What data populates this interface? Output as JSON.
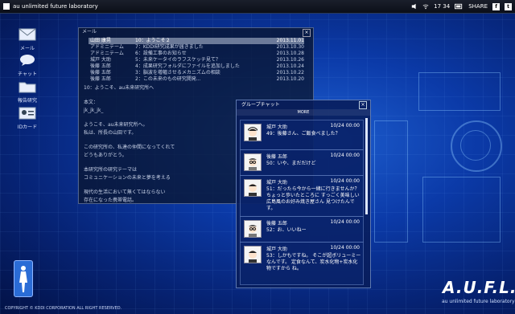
{
  "topbar": {
    "brand": "au unlimited future laboratory",
    "time": "17 34",
    "share": "SHARE",
    "f": "f",
    "t": "t"
  },
  "desktop": [
    {
      "label": "メール",
      "icon": "mail-icon"
    },
    {
      "label": "チャット",
      "icon": "chat-icon"
    },
    {
      "label": "報告研究",
      "icon": "folder-icon"
    },
    {
      "label": "IDカード",
      "icon": "id-card-icon"
    }
  ],
  "mail": {
    "title": "メール",
    "close": "×",
    "rows": [
      {
        "from": "山田 康晃",
        "subject": "10：ようこそ２",
        "date": "2013.11.01"
      },
      {
        "from": "アドミニテーム",
        "subject": "7：KDDI研究成果が届きました",
        "date": "2013.10.30"
      },
      {
        "from": "アドミニテーム",
        "subject": "6：設備工事のお知らせ",
        "date": "2013.10.28"
      },
      {
        "from": "城戸 大助",
        "subject": "5：未来ケータイのラフスケッチ見て？",
        "date": "2013.10.26"
      },
      {
        "from": "後藤 五郎",
        "subject": "4：成果研究フォルダにファイルを追加しました",
        "date": "2013.10.24"
      },
      {
        "from": "後藤 五郎",
        "subject": "3：脳波を増幅させるメカニズムの相談",
        "date": "2013.10.22"
      },
      {
        "from": "後藤 五郎",
        "subject": "2：この未来のもの研究開発...",
        "date": "2013.10.20"
      }
    ],
    "body": [
      "10：ようこそ、au未来研究所へ",
      "",
      "本文：",
      "jk_jk_jk_",
      "",
      "ようこそ、au未来研究所へ。",
      "私は、所長の山田です。",
      "",
      "この研究所の、私達の仲間になってくれて",
      "どうもありがとう。",
      "",
      "本研究所の研究テーマは",
      "コミュニケーションの未来と夢を考える",
      "",
      "現代の生活において無くてはならない",
      "存在になった携帯電話。"
    ]
  },
  "chat": {
    "title": "グループチャット",
    "close": "×",
    "more": "MORE",
    "messages": [
      {
        "name": "城戸 大助",
        "time": "10/24 00:00",
        "text": "49：後藤さん、ご飯食べました？"
      },
      {
        "name": "後藤 五郎",
        "time": "10/24 00:00",
        "text": "50：いや、まだだけど"
      },
      {
        "name": "城戸 大助",
        "time": "10/24 00:00",
        "text": "51：だったら今から一緒に行きませんか？ ちょっと歩いたところに すっごく美味しい広島風のお好み焼き屋さん 見つけたんです。"
      },
      {
        "name": "後藤 五郎",
        "time": "10/24 00:00",
        "text": "52：お、いいねー"
      },
      {
        "name": "城戸 大助",
        "time": "10/24 00:00",
        "text": "53：しかもですね。 そこが超ボリューミーなんです。 定食なんて、炭水化物+炭水化物ですから ね。"
      }
    ]
  },
  "footer": {
    "copyright": "COPYRIGHT © KDDI CORPORATION ALL RIGHT RESERVED.",
    "logo": "A.U.F.L.",
    "logo_sub": "au unlimited future laboratory"
  }
}
